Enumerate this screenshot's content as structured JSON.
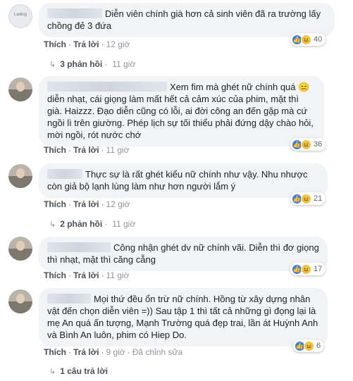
{
  "comments": [
    {
      "avatar_text": "Lading",
      "text": "Diễn viên chính già hơn cả sinh viên đã ra trường lấy chồng đẻ 3 đứa",
      "actions": {
        "like": "Thích",
        "reply": "Trả lời",
        "time": "12 giờ"
      },
      "reaction_count": "40",
      "replies": {
        "label": "3 phản hồi",
        "time": "11 giờ"
      }
    },
    {
      "text": "Xem fim mà ghét nữ chính quá 😑 diễn nhạt, cái giọng làm mất hết cả cảm xúc của phim, mặt thì già. Haizzz. Đạo diễn cũng có lỗi, ai đời công an đến gặp mà cứ ngồi lì trên giường. Phép lịch sự tối thiểu phải đứng dậy chào hỏi, mời ngồi, rót nước chớ",
      "actions": {
        "like": "Thích",
        "reply": "Trả lời",
        "time": "11 giờ"
      },
      "reaction_count": "36"
    },
    {
      "text": "Thực sự là rất ghét kiểu nữ chính như vậy. Nhu nhược còn giả bộ lạnh lùng làm như hơn người lắm ý",
      "actions": {
        "like": "Thích",
        "reply": "Trả lời",
        "time": "12 giờ"
      },
      "reaction_count": "21",
      "replies": {
        "label": "2 phản hồi",
        "time": "11 giờ"
      }
    },
    {
      "text": "Công nhận ghét dv nữ chính vãi. Diễn thì đơ giọng thì nhạt, mặt thì căng cẵng",
      "actions": {
        "like": "Thích",
        "reply": "Trả lời",
        "time": "11 giờ"
      },
      "reaction_count": "17"
    },
    {
      "text": "Mọi thứ đều ổn trừ nữ chính. Hồng từ xây dựng nhân vật đến chọn diễn viên =)) Sau tập 1 thì tất cả những gì đọng lại là mẹ An quá ấn tượng, Mạnh Trường quá đẹp trai, lần át Huỳnh Anh và Bình An luôn, phim có Hiep Do.",
      "actions": {
        "like": "Thích",
        "reply": "Trả lời",
        "time": "9 giờ",
        "edited": "Đã chỉnh sửa"
      },
      "reaction_count": "6",
      "replies": {
        "label": "1 câu trả lời"
      }
    }
  ],
  "icons": {
    "like": "thumbs-up-icon",
    "haha": "laughing-face-icon",
    "reply_arrow": "reply-arrow-icon"
  },
  "colors": {
    "bubble": "#f2f3f5",
    "like_blue": "#3b7ff5",
    "haha_yellow": "#f7c340"
  }
}
